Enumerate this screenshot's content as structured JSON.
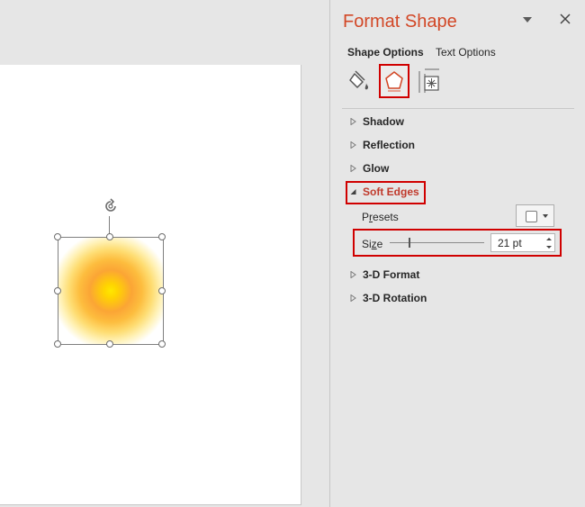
{
  "pane": {
    "title": "Format Shape",
    "tabs": {
      "shape_options": "Shape Options",
      "text_options": "Text Options"
    },
    "icon_tabs": [
      "paint-bucket-icon",
      "pentagon-effects-icon",
      "size-properties-icon"
    ],
    "selected_icon_tab": "pentagon-effects-icon",
    "sections": {
      "shadow": "Shadow",
      "reflection": "Reflection",
      "glow": "Glow",
      "soft_edges": "Soft Edges",
      "format_3d": "3-D Format",
      "rotation_3d": "3-D Rotation"
    },
    "soft_edges": {
      "presets_label_pre": "P",
      "presets_label_u": "r",
      "presets_label_post": "esets",
      "size_label_pre": "Si",
      "size_label_u": "z",
      "size_label_post": "e",
      "size_value": "21 pt",
      "size_slider_fraction": 0.2
    }
  },
  "colors": {
    "title_accent": "#d24726",
    "highlight_box": "#d00000",
    "shape_center": "#ffe800",
    "shape_ring": "#fba535"
  }
}
